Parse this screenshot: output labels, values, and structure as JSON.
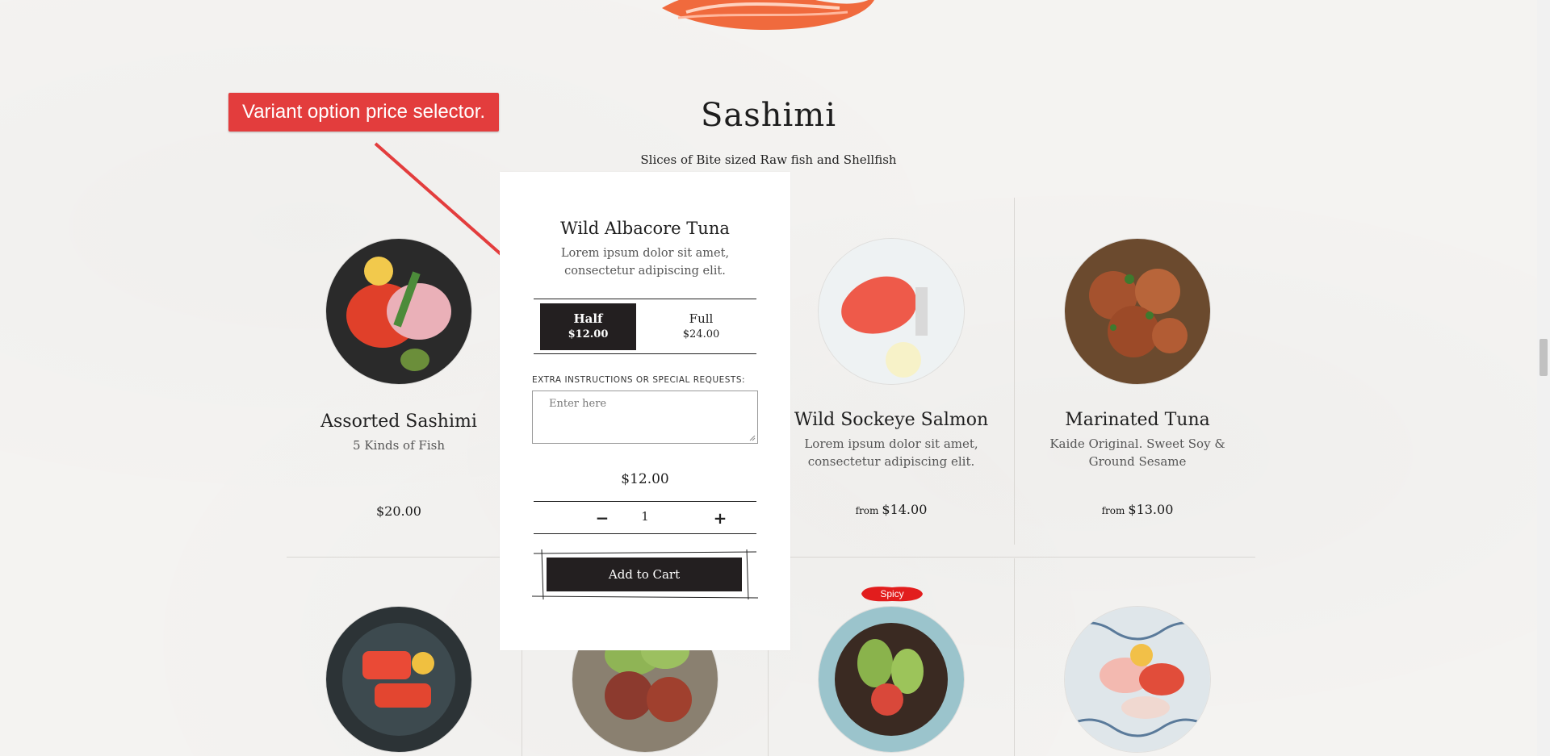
{
  "section": {
    "title": "Sashimi",
    "subtitle": "Slices of Bite sized Raw fish and Shellfish"
  },
  "annotation": {
    "text": "Variant option price selector."
  },
  "items": [
    {
      "name": "Assorted Sashimi",
      "desc": "5 Kinds of Fish",
      "price_prefix": "",
      "price": "$20.00"
    },
    {
      "name": "Wild Sockeye Salmon",
      "desc": "Lorem ipsum dolor sit amet, consectetur adipiscing elit.",
      "price_prefix": "from",
      "price": "$14.00"
    },
    {
      "name": "Marinated Tuna",
      "desc": "Kaide Original. Sweet Soy & Ground Sesame",
      "price_prefix": "from",
      "price": "$13.00"
    }
  ],
  "badge": {
    "spicy": "Spicy"
  },
  "modal": {
    "title": "Wild Albacore Tuna",
    "desc": "Lorem ipsum dolor sit amet, consectetur adipiscing elit.",
    "variants": [
      {
        "name": "Half",
        "price": "$12.00",
        "selected": true
      },
      {
        "name": "Full",
        "price": "$24.00",
        "selected": false
      }
    ],
    "instructions_label": "EXTRA INSTRUCTIONS OR SPECIAL REQUESTS:",
    "instructions_placeholder": "Enter here",
    "total": "$12.00",
    "qty_minus": "−",
    "qty_plus": "+",
    "quantity": "1",
    "add_to_cart": "Add to Cart"
  },
  "colors": {
    "accent_red": "#e33d3d",
    "button_dark": "#231f20",
    "background": "#f4f3f1"
  }
}
